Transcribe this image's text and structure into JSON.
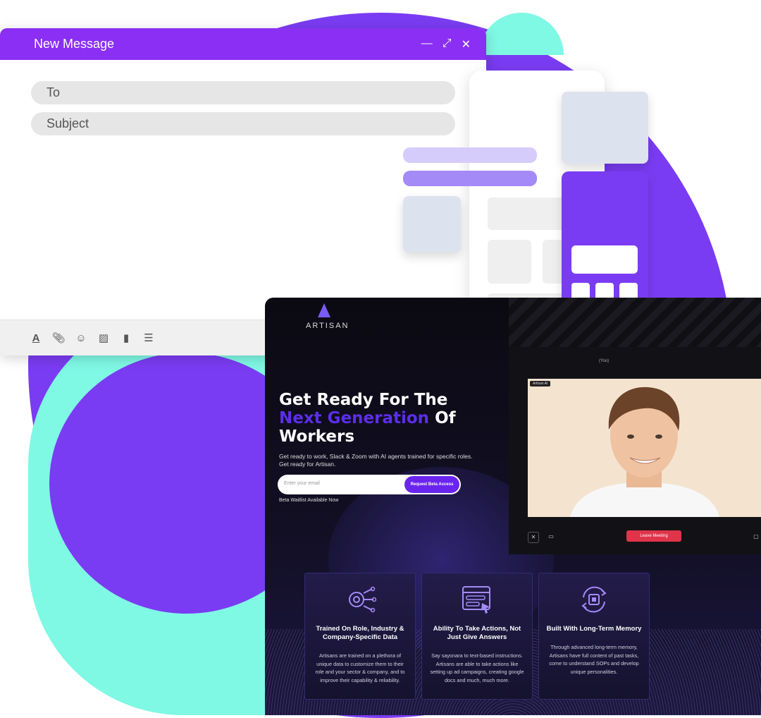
{
  "mail": {
    "title": "New Message",
    "to_placeholder": "To",
    "subject_placeholder": "Subject",
    "toolbar": [
      "text-format-icon",
      "attach-icon",
      "emoji-icon",
      "image-icon",
      "trash-icon",
      "more-icon"
    ]
  },
  "site": {
    "logo_text": "ARTISAN",
    "hero_line1": "Get Ready For The",
    "hero_accent": "Next Generation",
    "hero_line2_rest": " Of",
    "hero_line3": "Workers",
    "subtitle": "Get ready to work, Slack & Zoom with AI agents trained for specific roles. Get ready for Artisan.",
    "email_placeholder": "Enter your email",
    "cta_label": "Request Beta Access",
    "beta_text": "Beta Waitlist Available Now",
    "call": {
      "you_label": "(You)",
      "badge": "Artisan AI",
      "leave_label": "Leave Meeting"
    },
    "cards": [
      {
        "title": "Trained On Role, Industry & Company-Specific Data",
        "body": "Artisans are trained on a plethora of unique data to customize them to their role and your sector & company, and to improve their capability & reliability."
      },
      {
        "title": "Ability To Take Actions, Not Just Give Answers",
        "body": "Say sayonara to text-based instructions. Artisans are able to take actions like setting up ad campaigns, creating google docs and much, much more."
      },
      {
        "title": "Built With Long-Term Memory",
        "body": "Through advanced long-term memory, Artisans have full content of past tasks, come to understand SOPs and develop unique personalities."
      }
    ]
  },
  "colors": {
    "brand_purple": "#7a3cf2",
    "accent_teal": "#7ff8e4",
    "leave_red": "#e0344a"
  }
}
